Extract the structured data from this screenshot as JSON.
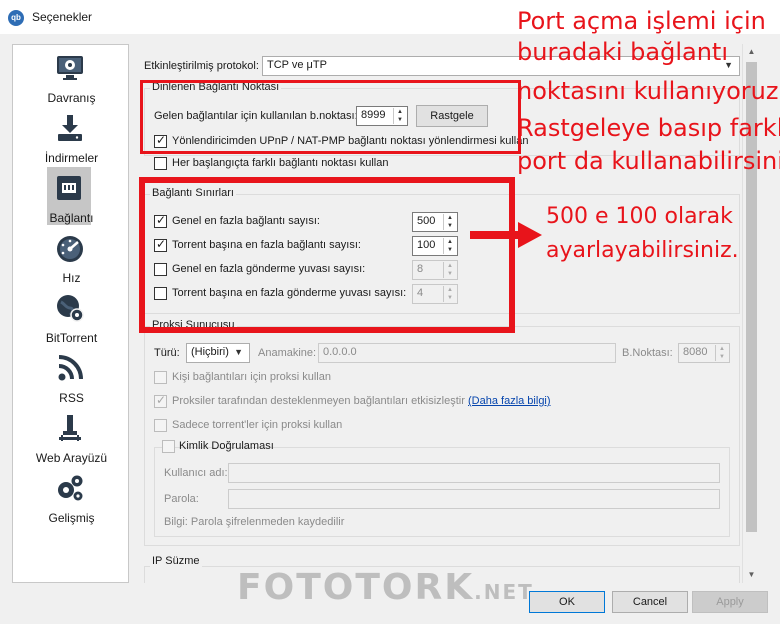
{
  "window": {
    "title": "Seçenekler",
    "app_icon": "qb"
  },
  "sidebar": {
    "items": [
      {
        "label": "Davranış",
        "icon": "monitor-gear-icon"
      },
      {
        "label": "İndirmeler",
        "icon": "download-icon"
      },
      {
        "label": "Bağlantı",
        "icon": "network-icon",
        "active": true
      },
      {
        "label": "Hız",
        "icon": "speedometer-icon"
      },
      {
        "label": "BitTorrent",
        "icon": "globe-gear-icon"
      },
      {
        "label": "RSS",
        "icon": "rss-icon"
      },
      {
        "label": "Web Arayüzü",
        "icon": "web-ui-icon"
      },
      {
        "label": "Gelişmiş",
        "icon": "gears-icon"
      }
    ]
  },
  "protocol": {
    "label": "Etkinleştirilmiş protokol:",
    "value": "TCP ve μTP"
  },
  "listening": {
    "title": "Dinlenen Bağlantı Noktası",
    "port_label": "Gelen bağlantılar için kullanılan b.noktası:",
    "port_value": "8999",
    "random_button": "Rastgele",
    "upnp_label": "Yönlendiricimden UPnP / NAT-PMP bağlantı noktası yönlendirmesi kullan",
    "upnp_checked": true,
    "random_each_start_label": "Her başlangıçta farklı bağlantı noktası kullan",
    "random_each_start_checked": false
  },
  "limits": {
    "title": "Bağlantı Sınırları",
    "rows": [
      {
        "label": "Genel en fazla bağlantı sayısı:",
        "value": "500",
        "checked": true
      },
      {
        "label": "Torrent başına en fazla bağlantı sayısı:",
        "value": "100",
        "checked": true
      },
      {
        "label": "Genel en fazla gönderme yuvası sayısı:",
        "value": "8",
        "checked": false
      },
      {
        "label": "Torrent başına en fazla gönderme yuvası sayısı:",
        "value": "4",
        "checked": false
      }
    ]
  },
  "proxy": {
    "title": "Proksi Sunucusu",
    "type_label": "Türü:",
    "type_value": "(Hiçbiri)",
    "host_label": "Anamakine:",
    "host_value": "0.0.0.0",
    "port_label": "B.Noktası:",
    "port_value": "8080",
    "peer_label": "Kişi bağlantıları için proksi kullan",
    "disable_label": "Proksiler tarafından desteklenmeyen bağlantıları etkisizleştir",
    "more_info": "(Daha fazla bilgi)",
    "torrent_only_label": "Sadece torrent'ler için proksi kullan",
    "auth_title": "Kimlik Doğrulaması",
    "username_label": "Kullanıcı adı:",
    "password_label": "Parola:",
    "info_text": "Bilgi: Parola şifrelenmeden kaydedilir"
  },
  "ip_filter": {
    "title": "IP Süzme"
  },
  "buttons": {
    "ok": "OK",
    "cancel": "Cancel",
    "apply": "Apply"
  },
  "annotations": {
    "port_note": [
      "Port açma işlemi için",
      "buradaki bağlantı",
      "noktasını kullanıyoruz.",
      "Rastgeleye basıp farklı",
      "port da kullanabilirsiniz"
    ],
    "limit_note": [
      "500 e 100 olarak",
      "ayarlayabilirsiniz."
    ],
    "color": "#e8141b"
  },
  "watermark": {
    "main": "FOTOTORK",
    "suffix": ".NET"
  }
}
